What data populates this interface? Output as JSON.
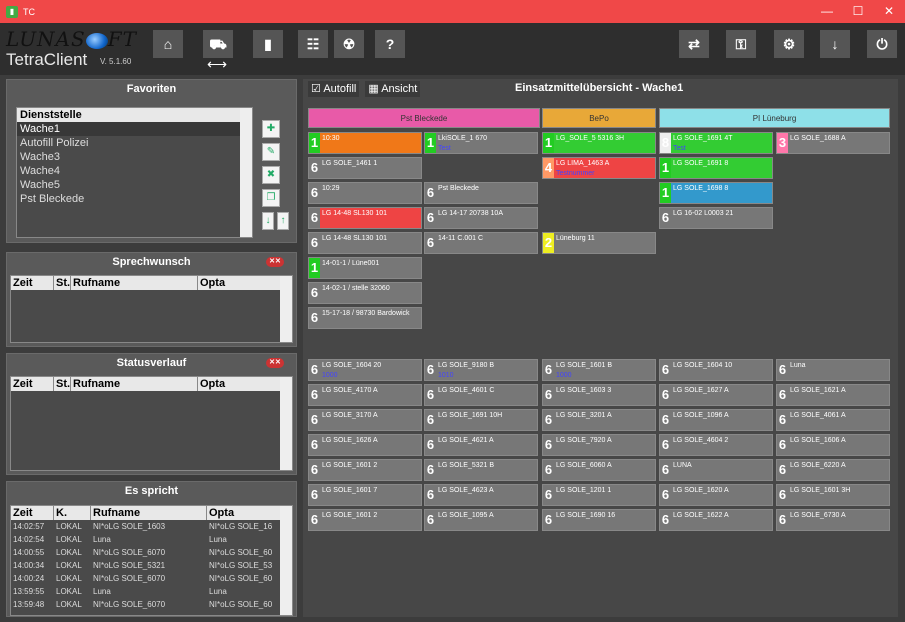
{
  "window": {
    "title": "TC"
  },
  "app": {
    "logo_text": "LUNASOFT",
    "title": "TetraClient",
    "version": "V. 5.1.60"
  },
  "toolbar": {
    "left_icons": [
      "home-icon",
      "vehicles-icon",
      "radio-icon",
      "tree-icon",
      "radiation-icon",
      "help-icon"
    ],
    "help_label": "?",
    "right_icons": [
      "swap-icon",
      "key-icon",
      "gear-icon",
      "download-icon",
      "power-icon"
    ]
  },
  "favoriten": {
    "title": "Favoriten",
    "header": "Dienststelle",
    "items": [
      "Wache1",
      "Autofill Polizei",
      "Wache3",
      "Wache4",
      "Wache5",
      "Pst Bleckede"
    ]
  },
  "sprechwunsch": {
    "title": "Sprechwunsch",
    "columns": [
      "Zeit",
      "St.",
      "Rufname",
      "Opta"
    ]
  },
  "statusverlauf": {
    "title": "Statusverlauf",
    "columns": [
      "Zeit",
      "St.",
      "Rufname",
      "Opta"
    ]
  },
  "esspricht": {
    "title": "Es spricht",
    "columns": [
      "Zeit",
      "K.",
      "Rufname",
      "Opta"
    ],
    "rows": [
      [
        "14:02:57",
        "LOKAL",
        "NI*oLG SOLE_1603",
        "NI*oLG SOLE_16"
      ],
      [
        "14:02:54",
        "LOKAL",
        "Luna",
        "Luna"
      ],
      [
        "14:00:55",
        "LOKAL",
        "NI*oLG SOLE_6070",
        "NI*oLG SOLE_60"
      ],
      [
        "14:00:34",
        "LOKAL",
        "NI*oLG SOLE_5321",
        "NI*oLG SOLE_53"
      ],
      [
        "14:00:24",
        "LOKAL",
        "NI*oLG SOLE_6070",
        "NI*oLG SOLE_60"
      ],
      [
        "13:59:55",
        "LOKAL",
        "Luna",
        "Luna"
      ],
      [
        "13:59:48",
        "LOKAL",
        "NI*oLG SOLE_6070",
        "NI*oLG SOLE_60"
      ]
    ]
  },
  "main": {
    "autofill": "Autofill",
    "ansicht": "Ansicht",
    "title": "Einsatzmittelübersicht - Wache1",
    "columns": [
      {
        "label": "Pst Bleckede",
        "color": "#e85aa8"
      },
      {
        "label": "BePo",
        "color": "#e8a838"
      },
      {
        "label": "PI Lüneburg",
        "color": "#8ee0e8"
      }
    ],
    "cards": [
      {
        "s": "1",
        "t": "10:30",
        "c": "#f07818",
        "sc": "#2c2"
      },
      {
        "s": "1",
        "t": "LkiSOLE_1 670",
        "sub": "Test",
        "c": "#777",
        "sc": "#2c2"
      },
      {
        "s": "1",
        "t": "LG_SOLE_5 5316  3H",
        "c": "#3c3",
        "sc": "#2c2"
      },
      {
        "s": "8",
        "t": "LG SOLE_1691  4T",
        "sub": "Test",
        "c": "#3c3",
        "sc": "#eee"
      },
      {
        "s": "3",
        "t": "LG SOLE_1688   A",
        "c": "#777",
        "sc": "#f7a"
      },
      {
        "s": "6",
        "t": "LG SOLE_1461   1",
        "c": "#777",
        "sc": "#777"
      },
      {
        "s": "4",
        "t": "LG LIMA_1463   A",
        "sub": "Testnummer",
        "c": "#e44",
        "sc": "#f96"
      },
      {
        "s": "1",
        "t": "LG SOLE_1691   8",
        "c": "#3c3",
        "sc": "#2c2"
      },
      {
        "s": "6",
        "t": "10:29",
        "c": "#777",
        "sc": "#777"
      },
      {
        "s": "6",
        "t": "Pst Bleckede",
        "c": "#777",
        "sc": "#777"
      },
      {
        "s": "1",
        "t": "LG SOLE_1698   8",
        "c": "#39c",
        "sc": "#2c2"
      },
      {
        "s": "6",
        "t": "LG 14-48 SL130  101",
        "c": "#e44",
        "sc": "#777"
      },
      {
        "s": "6",
        "t": "LG 14-17 20738  10A",
        "c": "#777",
        "sc": "#777"
      },
      {
        "s": "6",
        "t": "LG 16-02 L0003  21",
        "c": "#777",
        "sc": "#777"
      },
      {
        "s": "6",
        "t": "LG 14-48 SL130  101",
        "c": "#777",
        "sc": "#777"
      },
      {
        "s": "6",
        "t": "14-11 C.001  C",
        "c": "#777",
        "sc": "#777"
      },
      {
        "s": "2",
        "t": "Lüneburg 11",
        "c": "#777",
        "sc": "#ee2"
      },
      {
        "s": "1",
        "t": "14-01-1 / Lüne001",
        "c": "#777",
        "sc": "#2c2"
      },
      {
        "s": "6",
        "t": "14-02-1 / stelle 32060",
        "c": "#777",
        "sc": "#777"
      },
      {
        "s": "6",
        "t": "15-17-18 / 98730 Bardowick",
        "c": "#777",
        "sc": "#777"
      },
      {
        "s": "6",
        "t": "LG SOLE_1604  20",
        "sub": "1000",
        "c": "#777",
        "sc": "#777"
      },
      {
        "s": "6",
        "t": "LG SOLE_9180   B",
        "sub": "1010",
        "c": "#777",
        "sc": "#777"
      },
      {
        "s": "6",
        "t": "LG SOLE_1601   B",
        "sub": "1000",
        "c": "#777",
        "sc": "#777"
      },
      {
        "s": "6",
        "t": "LG SOLE_1604  10",
        "c": "#777",
        "sc": "#777"
      },
      {
        "s": "6",
        "t": "Luna",
        "c": "#777",
        "sc": "#777"
      }
    ],
    "grid_rows": [
      [
        "LG SOLE_4170  A",
        "LG SOLE_4601  C",
        "LG SOLE_1603  3",
        "LG SOLE_1627  A",
        "LG SOLE_1621  A"
      ],
      [
        "LG SOLE_3170  A",
        "LG SOLE_1691  10H",
        "LG SOLE_3201  A",
        "LG SOLE_1096  A",
        "LG SOLE_4061  A"
      ],
      [
        "LG SOLE_1626  A",
        "LG SOLE_4621  A",
        "LG SOLE_7920  A",
        "LG SOLE_4604  2",
        "LG SOLE_1606  A"
      ],
      [
        "LG SOLE_1601  2",
        "LG SOLE_5321  B",
        "LG SOLE_6060  A",
        "LUNA",
        "LG SOLE_6220  A"
      ],
      [
        "LG SOLE_1601  7",
        "LG SOLE_4623  A",
        "LG SOLE_1201  1",
        "LG SOLE_1620  A",
        "LG SOLE_1601  3H"
      ],
      [
        "LG SOLE_1601  2",
        "LG SOLE_1095  A",
        "LG SOLE_1690  16",
        "LG SOLE_1622  A",
        "LG SOLE_6730  A"
      ]
    ]
  }
}
